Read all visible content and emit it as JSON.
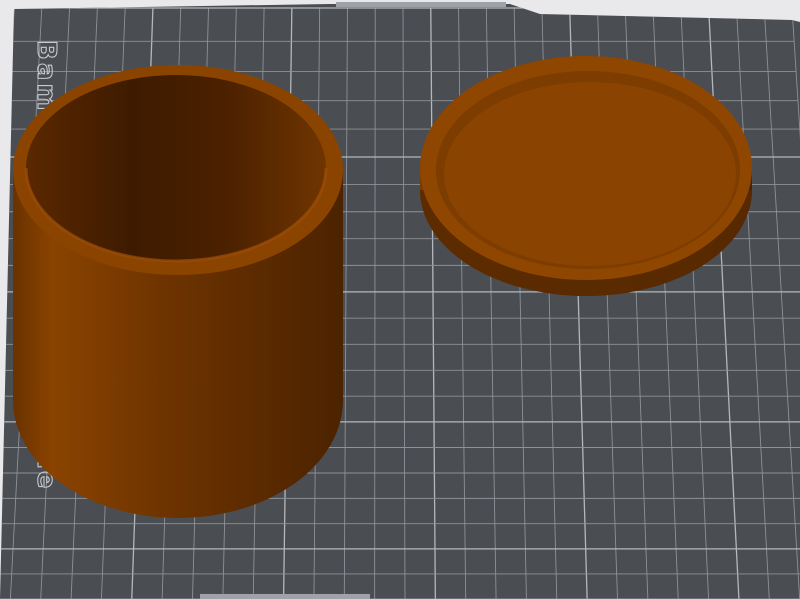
{
  "app": {
    "view": "3D build plate view"
  },
  "plate": {
    "brand_text": "Bambu Textured PEI Plate",
    "plate_color": "#4a4d52",
    "grid_color": "#8e9196",
    "major_grid_color": "#b4b7bb",
    "background_color": "#e9e9ec"
  },
  "objects": [
    {
      "name": "cylinder container body",
      "color": "#8a4100"
    },
    {
      "name": "container lid",
      "color": "#8a4300"
    }
  ]
}
